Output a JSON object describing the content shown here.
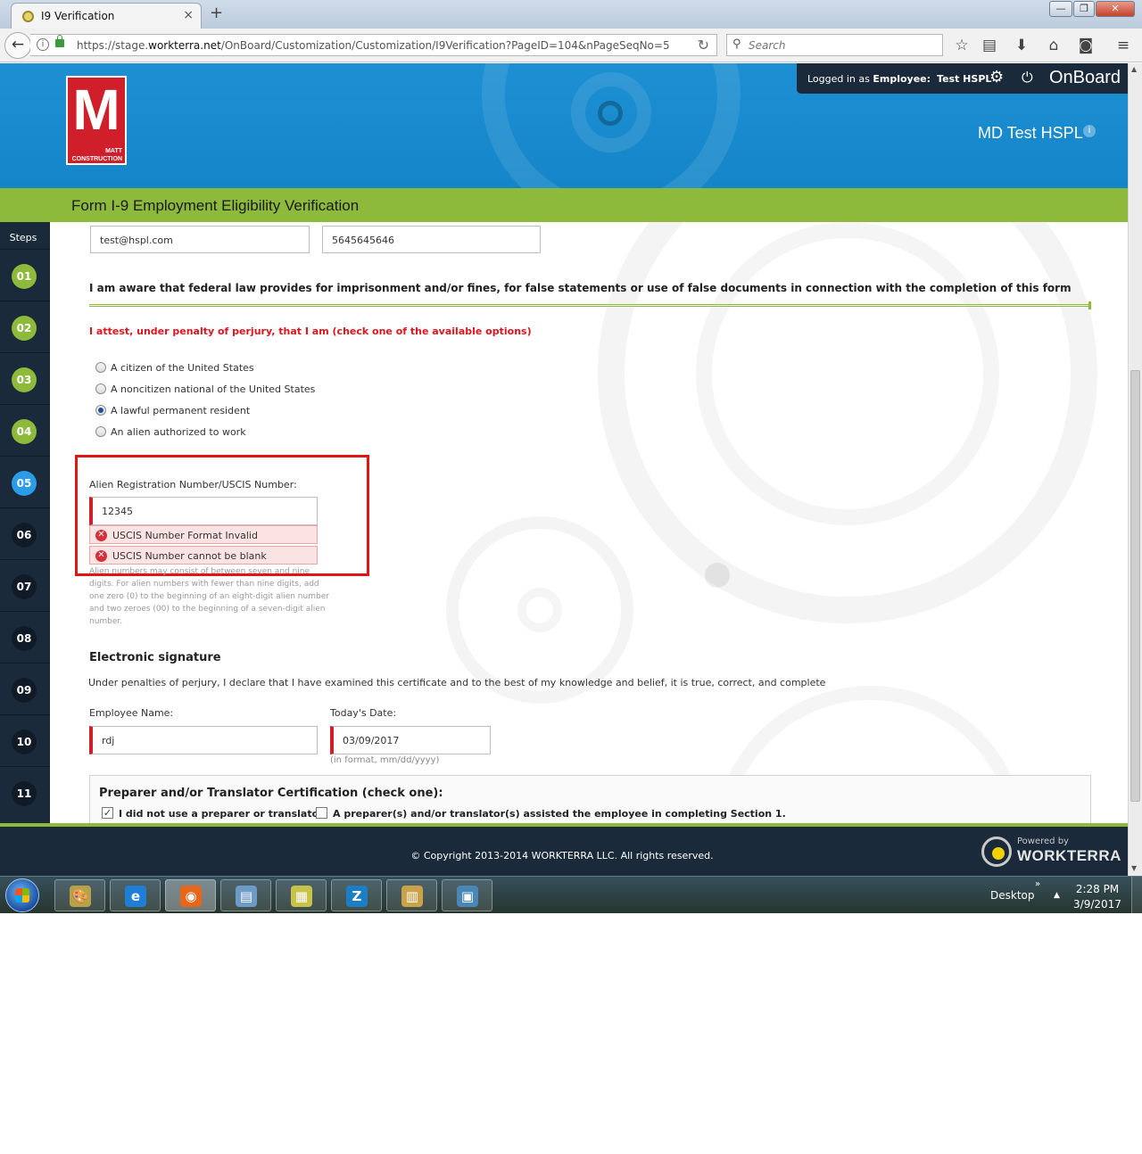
{
  "browser": {
    "tab_title": "I9 Verification",
    "new_tab": "+",
    "tab_close": "×",
    "url_host_prefix": "https://stage.",
    "url_host": "workterra.net",
    "url_path": "/OnBoard/Customization/Customization/I9Verification?PageID=104&nPageSeqNo=5",
    "search_placeholder": "Search",
    "window_buttons": {
      "minimize": "—",
      "maximize": "❐",
      "close": "✕"
    }
  },
  "header": {
    "logo_letter": "M",
    "logo_sub1": "MATT",
    "logo_sub2": "CONSTRUCTION",
    "login_prefix": "Logged in as ",
    "login_role": "Employee:",
    "login_name": "Test HSPL",
    "app_name": "OnBoard",
    "company": "MD Test HSPL",
    "info": "i"
  },
  "page_title": "Form I-9 Employment Eligibility Verification",
  "steps": {
    "label": "Steps",
    "items": [
      {
        "num": "01",
        "state": "done"
      },
      {
        "num": "02",
        "state": "done"
      },
      {
        "num": "03",
        "state": "done"
      },
      {
        "num": "04",
        "state": "done"
      },
      {
        "num": "05",
        "state": "active"
      },
      {
        "num": "06",
        "state": "todo"
      },
      {
        "num": "07",
        "state": "todo"
      },
      {
        "num": "08",
        "state": "todo"
      },
      {
        "num": "09",
        "state": "todo"
      },
      {
        "num": "10",
        "state": "todo"
      },
      {
        "num": "11",
        "state": "todo"
      }
    ]
  },
  "form": {
    "email_value": "test@hspl.com",
    "phone_value": "5645645646",
    "notice": "I am aware that federal law provides for imprisonment and/or fines, for false statements or use of false documents in connection with the completion of this form",
    "attest": "I attest, under penalty of perjury, that I am (check one of the available options)",
    "status_options": [
      {
        "label": "A citizen of the United States",
        "checked": false
      },
      {
        "label": "A noncitizen national of the United States",
        "checked": false
      },
      {
        "label": "A lawful permanent resident",
        "checked": true
      },
      {
        "label": "An alien authorized to work",
        "checked": false
      }
    ],
    "alien_label": "Alien Registration Number/USCIS Number:",
    "alien_value": "12345",
    "errors": [
      "USCIS Number Format Invalid",
      "USCIS Number cannot be blank"
    ],
    "help_text": "Alien numbers may consist of between seven and nine digits. For alien numbers with fewer than nine digits, add one zero (0) to the beginning of an eight-digit alien number and two zeroes (00) to the beginning of a seven-digit alien number.",
    "esig_heading": "Electronic signature",
    "esig_text": "Under penalties of perjury, I declare that I have examined this certificate and to the best of my knowledge and belief, it is true, correct, and complete",
    "employee_name_label": "Employee Name:",
    "employee_name_value": "rdj",
    "date_label": "Today's Date:",
    "date_value": "03/09/2017",
    "date_format": "(in format, mm/dd/yyyy)",
    "preparer_heading": "Preparer and/or Translator Certification (check one):",
    "preparer_options": [
      {
        "label": "I did not use a preparer or translator.",
        "checked": true
      },
      {
        "label": "A preparer(s) and/or translator(s) assisted the employee in completing Section 1.",
        "checked": false
      }
    ]
  },
  "footer": {
    "copyright": "© Copyright 2013-2014 WORKTERRA LLC. All rights reserved.",
    "powered_by": "Powered by",
    "brand": "WORKTERRA"
  },
  "taskbar": {
    "desktop": "Desktop",
    "chevron": "»",
    "tray_up": "▲",
    "time": "2:28 PM",
    "date": "3/9/2017",
    "apps": [
      {
        "name": "paint",
        "glyph": "🎨"
      },
      {
        "name": "internet-explorer",
        "glyph": "e"
      },
      {
        "name": "firefox",
        "glyph": "◉"
      },
      {
        "name": "notepad",
        "glyph": "▤"
      },
      {
        "name": "sticky-notes",
        "glyph": "▦"
      },
      {
        "name": "z-app",
        "glyph": "Z"
      },
      {
        "name": "file-explorer",
        "glyph": "▥"
      },
      {
        "name": "remote-desktop",
        "glyph": "▣"
      }
    ]
  },
  "colors": {
    "header_blue": "#1486c8",
    "lime": "#8dba3b",
    "navy": "#1b2a3b",
    "error_red": "#e01616",
    "active_step": "#2a9de6"
  }
}
